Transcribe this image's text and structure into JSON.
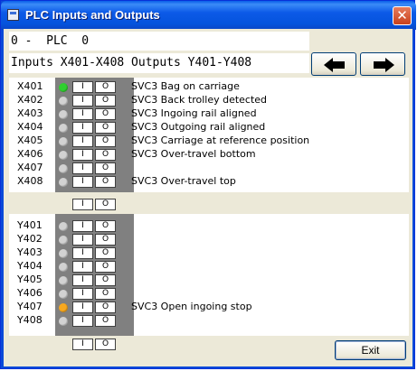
{
  "window": {
    "title": "PLC Inputs and Outputs",
    "close_glyph": "✕"
  },
  "plc_field": "0 -  PLC  0",
  "range_field": "Inputs X401-X408 Outputs Y401-Y408",
  "nav": {
    "prev_icon": "arrow-left-icon",
    "next_icon": "arrow-right-icon"
  },
  "button_labels": {
    "on": "I",
    "off": "O"
  },
  "inputs": [
    {
      "label": "X401",
      "led": "green",
      "desc": "SVC3 Bag on carriage"
    },
    {
      "label": "X402",
      "led": "off",
      "desc": "SVC3 Back trolley detected"
    },
    {
      "label": "X403",
      "led": "off",
      "desc": "SVC3 Ingoing rail aligned"
    },
    {
      "label": "X404",
      "led": "off",
      "desc": "SVC3 Outgoing rail aligned"
    },
    {
      "label": "X405",
      "led": "off",
      "desc": "SVC3 Carriage at reference position"
    },
    {
      "label": "X406",
      "led": "off",
      "desc": "SVC3 Over-travel bottom"
    },
    {
      "label": "X407",
      "led": "off",
      "desc": ""
    },
    {
      "label": "X408",
      "led": "off",
      "desc": "SVC3 Over-travel top"
    }
  ],
  "outputs": [
    {
      "label": "Y401",
      "led": "off",
      "desc": ""
    },
    {
      "label": "Y402",
      "led": "off",
      "desc": ""
    },
    {
      "label": "Y403",
      "led": "off",
      "desc": ""
    },
    {
      "label": "Y404",
      "led": "off",
      "desc": ""
    },
    {
      "label": "Y405",
      "led": "off",
      "desc": ""
    },
    {
      "label": "Y406",
      "led": "off",
      "desc": ""
    },
    {
      "label": "Y407",
      "led": "orange",
      "desc": "SVC3 Open ingoing stop"
    },
    {
      "label": "Y408",
      "led": "off",
      "desc": ""
    }
  ],
  "colors": {
    "led_green": "#2fd02f",
    "led_orange": "#f7a81f",
    "led_off": "#d2d2d2"
  },
  "exit_label": "Exit"
}
